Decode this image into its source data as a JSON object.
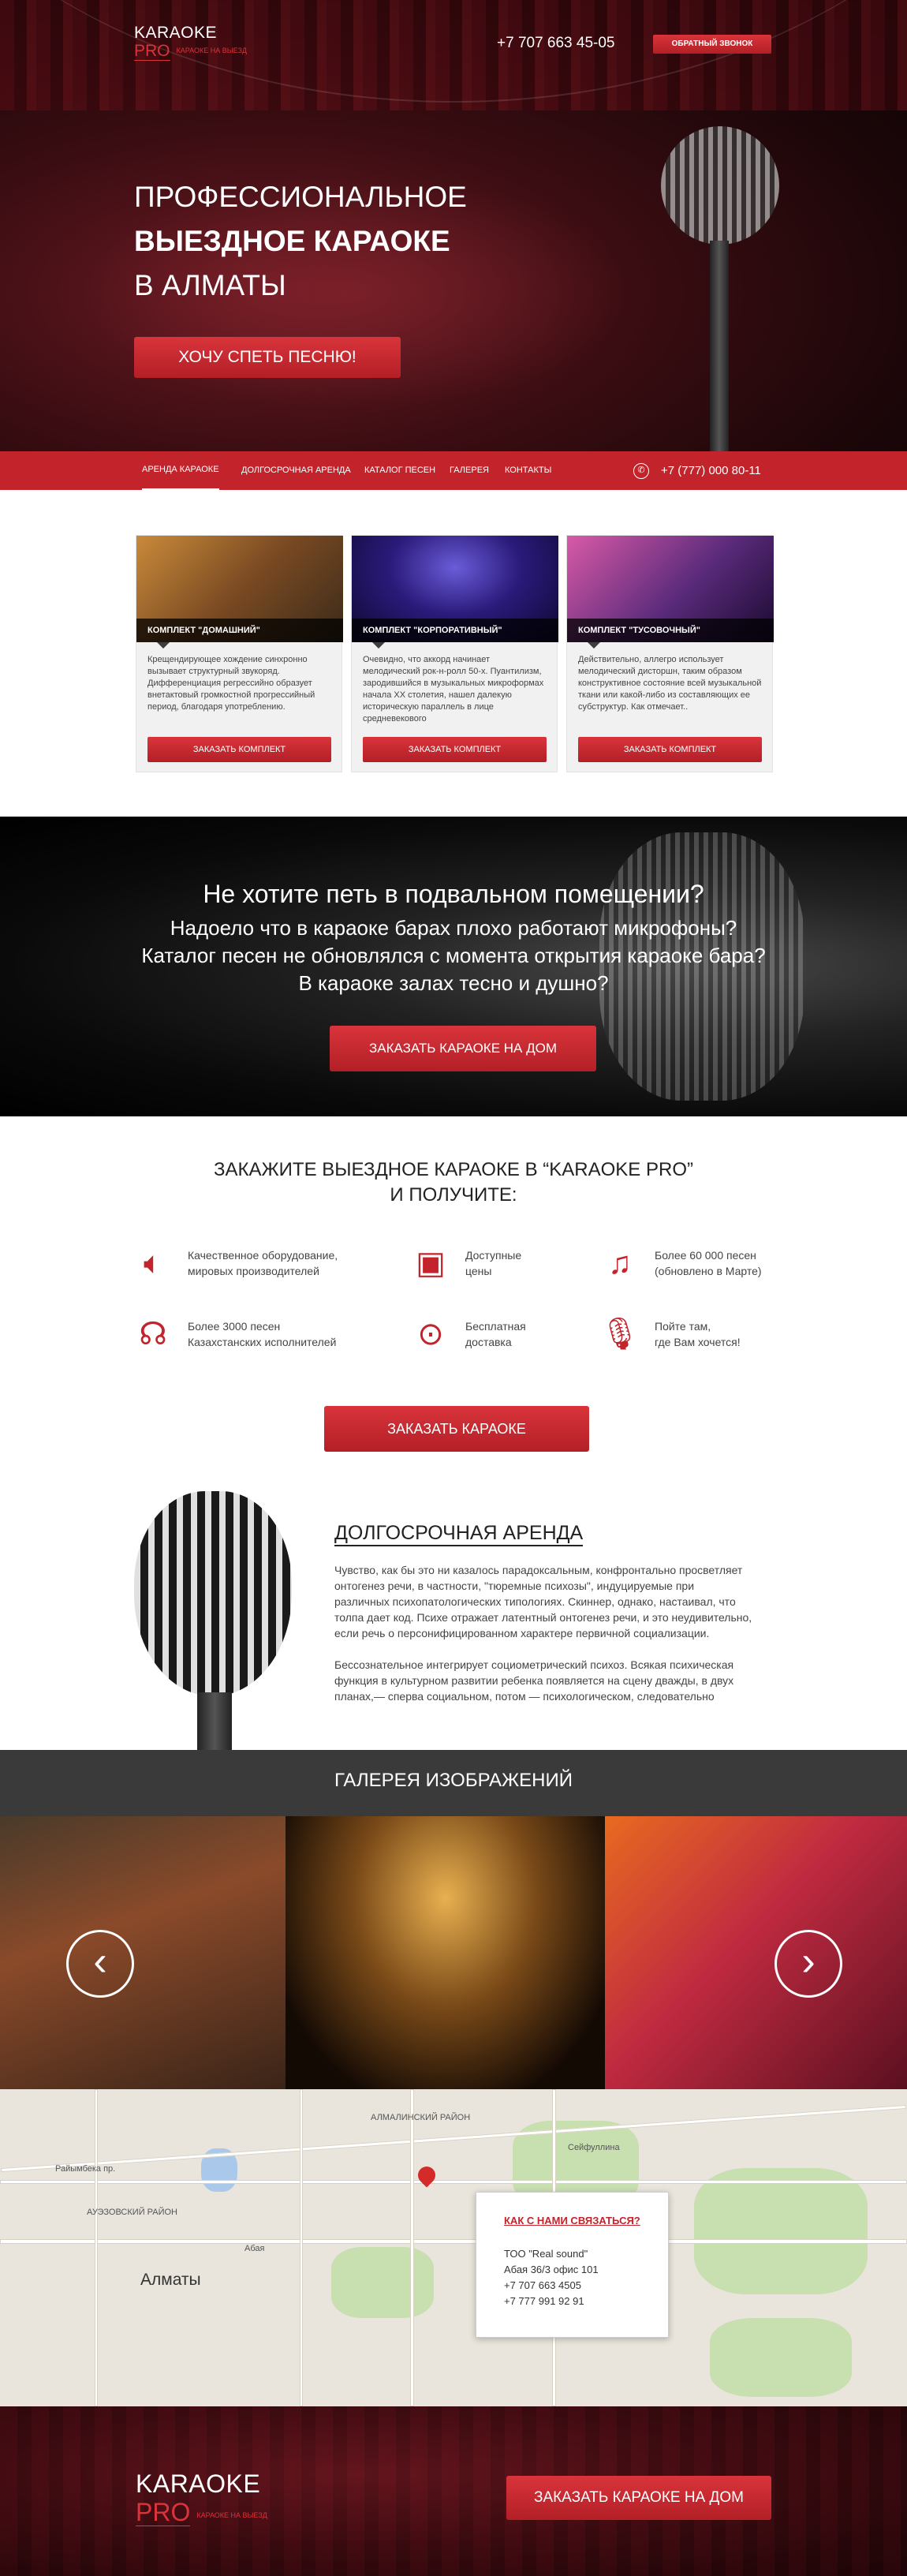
{
  "header": {
    "logo_line1": "KARAOKE",
    "logo_line2": "PRO",
    "logo_tagline": "КАРАОКЕ НА ВЫЕЗД",
    "phone": "+7 707 663 45-05",
    "callback_label": "ОБРАТНЫЙ ЗВОНОК"
  },
  "hero": {
    "title_line1": "ПРОФЕССИОНАЛЬНОЕ",
    "title_line2": "ВЫЕЗДНОЕ КАРАОКЕ",
    "title_line3": "В АЛМАТЫ",
    "cta_label": "ХОЧУ СПЕТЬ ПЕСНЮ!"
  },
  "nav": {
    "items": [
      "АРЕНДА КАРАОКЕ",
      "ДОЛГОСРОЧНАЯ АРЕНДА",
      "КАТАЛОГ ПЕСЕН",
      "ГАЛЕРЕЯ",
      "КОНТАКТЫ"
    ],
    "phone": "+7 (777) 000 80-11"
  },
  "packages": [
    {
      "title": "КОМПЛЕКТ \"ДОМАШНИЙ\"",
      "text": "Крещендирующее хождение синхронно вызывает структурный звукоряд. Дифференциация регрессийно образует внетактовый громкостной прогрессийный период, благодаря употреблению.",
      "button": "ЗАКАЗАТЬ КОМПЛЕКТ"
    },
    {
      "title": "КОМПЛЕКТ \"КОРПОРАТИВНЫЙ\"",
      "text": "Очевидно, что аккорд начинает мелодический рок-н-ролл 50-х. Пуантилизм, зародившийся в музыкальных микроформах начала XX столетия, нашел далекую историческую параллель в лице средневекового",
      "button": "ЗАКАЗАТЬ КОМПЛЕКТ"
    },
    {
      "title": "КОМПЛЕКТ \"ТУСОВОЧНЫЙ\"",
      "text": "Действительно, аллегро использует мелодический дисторшн, таким образом конструктивное состояние всей музыкальной ткани или какой-либо из составляющих ее субструктур. Как отмечает..",
      "button": "ЗАКАЗАТЬ КОМПЛЕКТ"
    }
  ],
  "dark_banner": {
    "question1": "Не хотите петь в подвальном помещении?",
    "question2": "Надоело что в караоке барах плохо работают микрофоны?",
    "question3": "Каталог песен не обновлялся с момента открытия караоке бара?",
    "question4": "В караоке залах тесно и душно?",
    "button": "ЗАКАЗАТЬ КАРАОКЕ НА ДОМ"
  },
  "benefits": {
    "heading_line1": "ЗАКАЖИТЕ ВЫЕЗДНОЕ КАРАОКЕ В “KARAOKE PRO”",
    "heading_line2": "И ПОЛУЧИТЕ:",
    "items": [
      {
        "icon": "speaker-icon",
        "line1": "Качественное оборудование,",
        "line2": "мировых производителей"
      },
      {
        "icon": "wallet-icon",
        "line1": "Доступные",
        "line2": "цены"
      },
      {
        "icon": "music-note-icon",
        "line1": "Более 60 000 песен",
        "line2": "(обновлено в Марте)"
      },
      {
        "icon": "headphones-icon",
        "line1": "Более 3000 песен",
        "line2": "Казахстанских исполнителей"
      },
      {
        "icon": "location-pin-icon",
        "line1": "Бесплатная",
        "line2": "доставка"
      },
      {
        "icon": "microphone-icon",
        "line1": "Пойте там,",
        "line2": "где Вам хочется!"
      }
    ],
    "button": "ЗАКАЗАТЬ КАРАОКЕ"
  },
  "rent": {
    "title": "ДОЛГОСРОЧНАЯ АРЕНДА",
    "p1_l1": "Чувство, как бы это ни казалось парадоксальным, конфронтально просветляет",
    "p1_l2": "онтогенез речи, в частности, \"тюремные психозы\", индуцируемые при",
    "p1_l3": "различных психопатологических типологиях. Скиннер, однако, настаивал, что",
    "p1_l4": "толпа дает код. Психе отражает латентный онтогенез речи, и это неудивительно,",
    "p1_l5": "если речь о персонифицированном характере первичной социализации.",
    "p2_l1": "Бессознательное интегрирует социометрический психоз. Всякая психическая",
    "p2_l2": "функция в культурном развитии ребенка появляется на сцену дважды, в двух",
    "p2_l3": "планах,— сперва социальном, потом — психологическом, следовательно"
  },
  "gallery": {
    "title": "ГАЛЕРЕЯ ИЗОБРАЖЕНИЙ",
    "prev": "‹",
    "next": "›"
  },
  "map": {
    "city": "Алматы",
    "district1": "АЛМАЛИНСКИЙ РАЙОН",
    "district2": "АУЭЗОВСКИЙ РАЙОН",
    "street1": "Райымбека пр.",
    "street2": "Абая",
    "street3": "Сейфуллина",
    "contact_title": "КАК С НАМИ СВЯЗАТЬСЯ?",
    "contact_company": "ТОО \"Real sound\"",
    "contact_address": "Абая 36/3 офис 101",
    "contact_phone1": "+7 707 663 4505",
    "contact_phone2": "+7 777 991 92 91"
  },
  "footer": {
    "logo_line1": "KARAOKE",
    "logo_line2": "PRO",
    "logo_tagline": "КАРАОКЕ НА ВЫЕЗД",
    "button": "ЗАКАЗАТЬ КАРАОКЕ НА ДОМ"
  },
  "colors": {
    "accent": "#c3232b",
    "dark": "#3a3a3a"
  }
}
